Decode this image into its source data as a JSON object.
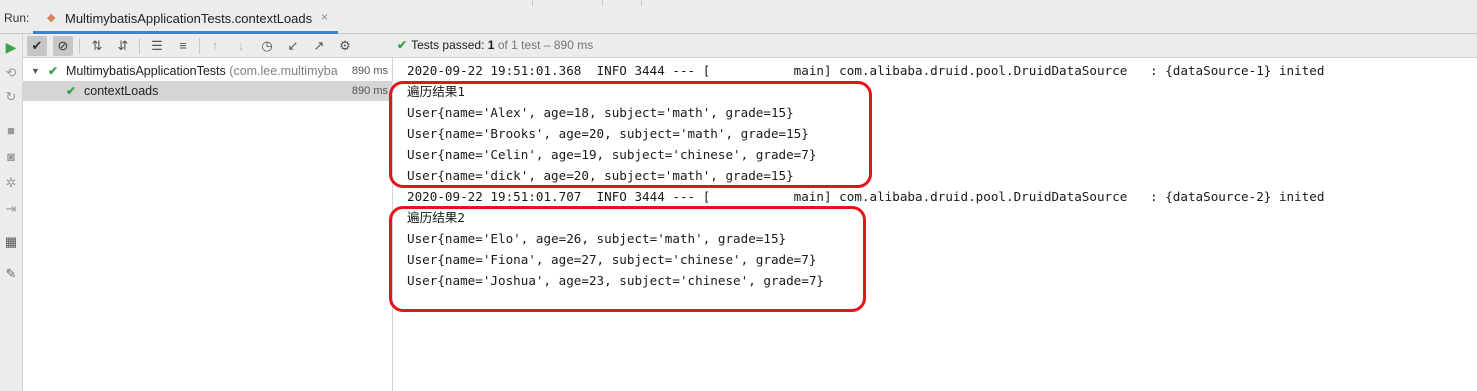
{
  "run_tab": {
    "run_label": "Run:",
    "tab_title": "MultimybatisApplicationTests.contextLoads",
    "close_glyph": "×"
  },
  "colors": {
    "pass": "#3aa34c",
    "highlight": "#e3141c",
    "tab_underline": "#4083c9"
  },
  "vertical_toolbar": [
    "play-icon",
    "rerun-failed-icon",
    "toggle-auto-test-icon",
    "stop-icon",
    "camera-icon",
    "debug-icon",
    "exit-icon",
    "layout-icon",
    "pin-icon"
  ],
  "test_toolbar": [
    "show-passed-icon",
    "show-ignored-icon",
    "sort-alpha-icon",
    "sort-duration-icon",
    "expand-all-icon",
    "collapse-all-icon",
    "prev-failed-icon",
    "next-failed-icon",
    "history-icon",
    "import-icon",
    "export-icon",
    "settings-icon"
  ],
  "status": {
    "text": "Tests passed:",
    "count": "1",
    "detail": "of 1 test – 890 ms"
  },
  "tree": {
    "root": {
      "name": "MultimybatisApplicationTests",
      "package": "(com.lee.multimyba",
      "duration": "890 ms"
    },
    "child": {
      "name": "contextLoads",
      "duration": "890 ms"
    }
  },
  "console": {
    "lines": [
      "2020-09-22 19:51:01.368  INFO 3444 --- [           main] com.alibaba.druid.pool.DruidDataSource   : {dataSource-1} inited",
      "遍历结果1",
      "User{name='Alex', age=18, subject='math', grade=15}",
      "User{name='Brooks', age=20, subject='math', grade=15}",
      "User{name='Celin', age=19, subject='chinese', grade=7}",
      "User{name='dick', age=20, subject='math', grade=15}",
      "2020-09-22 19:51:01.707  INFO 3444 --- [           main] com.alibaba.druid.pool.DruidDataSource   : {dataSource-2} inited",
      "遍历结果2",
      "User{name='Elo', age=26, subject='math', grade=15}",
      "User{name='Fiona', age=27, subject='chinese', grade=7}",
      "User{name='Joshua', age=23, subject='chinese', grade=7}"
    ]
  }
}
